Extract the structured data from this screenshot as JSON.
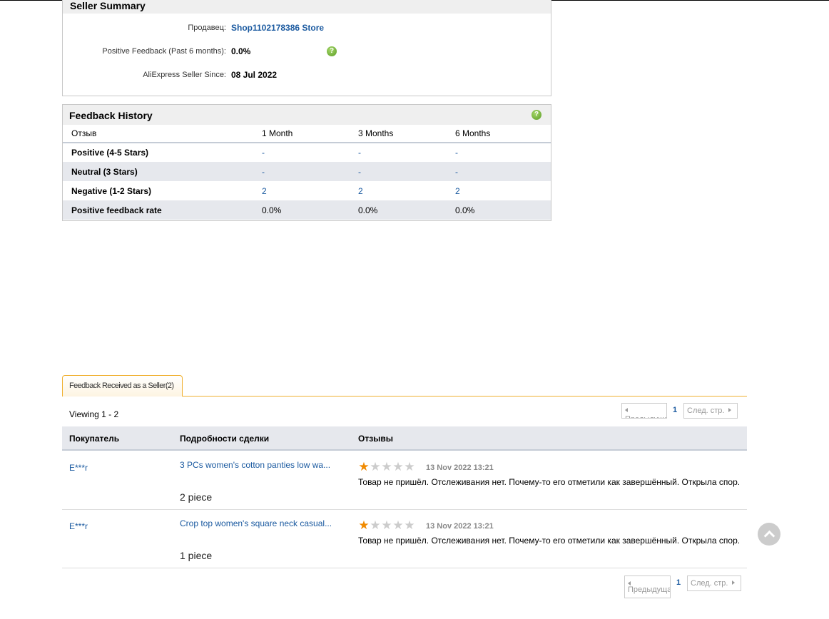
{
  "seller_summary": {
    "title": "Seller Summary",
    "seller_label": "Продавец:",
    "seller_name": "Shop1102178386 Store",
    "positive_label": "Positive Feedback (Past 6 months):",
    "positive_value": "0.0%",
    "since_label": "AliExpress Seller Since:",
    "since_value": "08 Jul 2022",
    "help_icon": "?"
  },
  "feedback_history": {
    "title": "Feedback History",
    "help_icon": "?",
    "columns": [
      "Отзыв",
      "1 Month",
      "3 Months",
      "6 Months"
    ],
    "rows": [
      {
        "label": "Positive (4-5 Stars)",
        "values": [
          "-",
          "-",
          "-"
        ]
      },
      {
        "label": "Neutral (3 Stars)",
        "values": [
          "-",
          "-",
          "-"
        ]
      },
      {
        "label": "Negative (1-2 Stars)",
        "values": [
          "2",
          "2",
          "2"
        ]
      },
      {
        "label": "Positive feedback rate",
        "values": [
          "0.0%",
          "0.0%",
          "0.0%"
        ]
      }
    ]
  },
  "tabs": {
    "active": "Feedback Received as a Seller(2)"
  },
  "viewing": "Viewing 1 - 2",
  "pager": {
    "prev": "Предыдущая",
    "current": "1",
    "next": "След. стр."
  },
  "feedback_table": {
    "columns": [
      "Покупатель",
      "Подробности сделки",
      "Отзывы"
    ],
    "rows": [
      {
        "buyer": "E***r",
        "product": "3 PCs women's cotton panties low wa...",
        "quantity": "2 piece",
        "stars": 1,
        "date": "13 Nov 2022 13:21",
        "review": "Товар не пришёл. Отслеживания нет. Почему-то его отметили как завершённый. Открыла спор."
      },
      {
        "buyer": "E***r",
        "product": "Crop top women's square neck casual...",
        "quantity": "1 piece",
        "stars": 1,
        "date": "13 Nov 2022 13:21",
        "review": "Товар не пришёл. Отслеживания нет. Почему-то его отметили как завершённый. Открыла спор."
      }
    ]
  },
  "colors": {
    "link": "#1b5aa0",
    "tab_border": "#f0b030",
    "star_on": "#f08a00",
    "star_off": "#cccccc"
  },
  "icons": {
    "help": "question-circle-icon",
    "star": "star-icon",
    "scroll_top": "chevron-up-icon"
  }
}
